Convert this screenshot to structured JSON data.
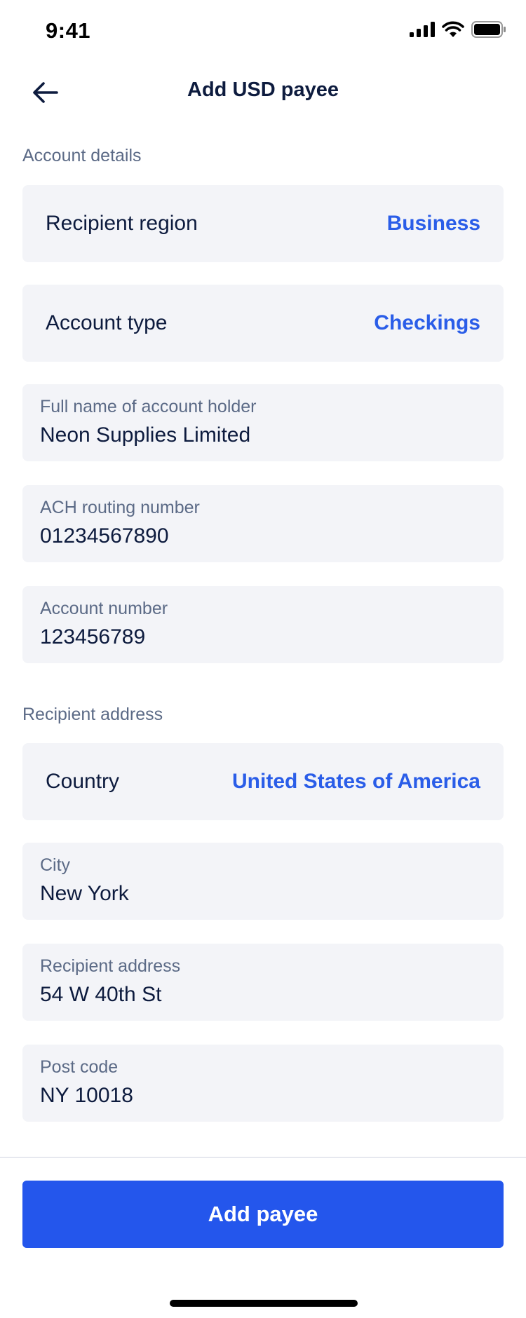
{
  "status_bar": {
    "time": "9:41",
    "icons": [
      "signal-icon",
      "wifi-icon",
      "battery-icon"
    ]
  },
  "header": {
    "title": "Add USD payee",
    "back_icon": "arrow-left-icon"
  },
  "account_details": {
    "section_label": "Account details",
    "recipient_region": {
      "label": "Recipient region",
      "value": "Business"
    },
    "account_type": {
      "label": "Account type",
      "value": "Checkings"
    },
    "account_holder": {
      "label": "Full name of account holder",
      "value": "Neon Supplies Limited"
    },
    "routing_number": {
      "label": "ACH routing number",
      "value": "01234567890"
    },
    "account_number": {
      "label": "Account number",
      "value": "123456789"
    }
  },
  "recipient_address": {
    "section_label": "Recipient address",
    "country": {
      "label": "Country",
      "value": "United States of America"
    },
    "city": {
      "label": "City",
      "value": "New York"
    },
    "address": {
      "label": "Recipient address",
      "value": "54 W 40th St"
    },
    "post_code": {
      "label": "Post code",
      "value": "NY 10018"
    }
  },
  "footer": {
    "add_button_label": "Add payee"
  },
  "colors": {
    "accent": "#2456ec",
    "link": "#2a5de8",
    "text_primary": "#0d1b3e",
    "text_secondary": "#5b6a86",
    "field_background": "#f3f4f8"
  }
}
